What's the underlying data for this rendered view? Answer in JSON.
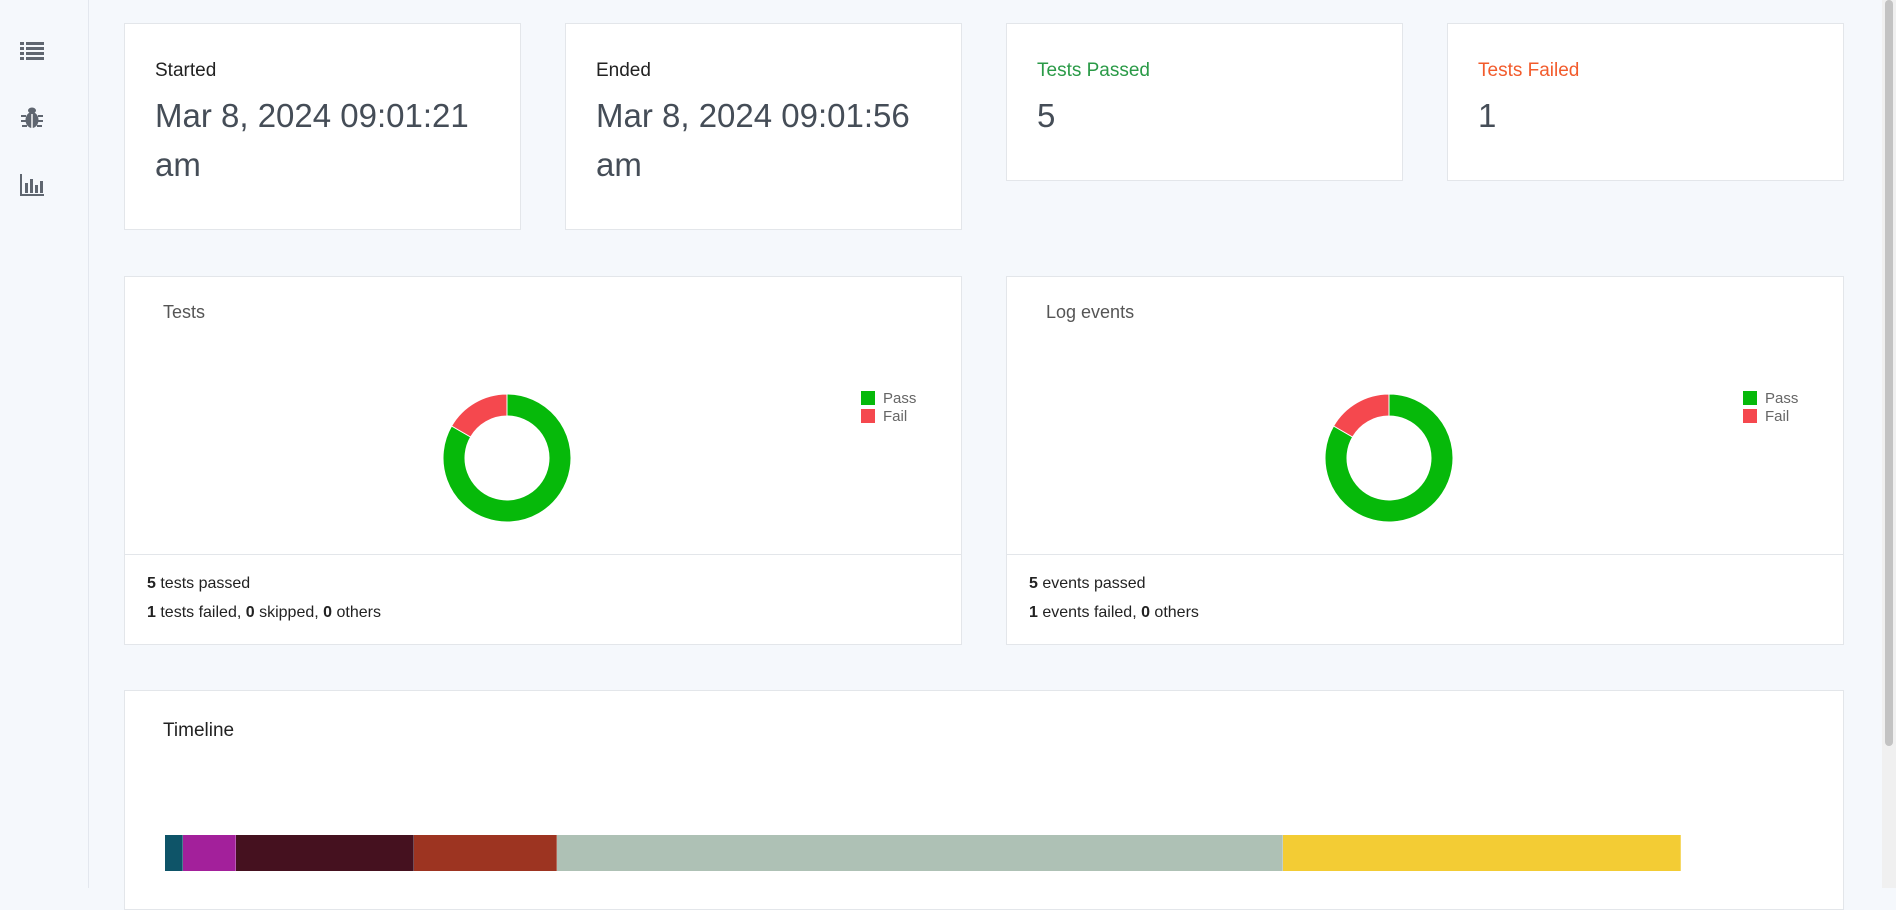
{
  "sidebar": {
    "items": [
      {
        "icon": "list-icon"
      },
      {
        "icon": "bug-icon"
      },
      {
        "icon": "bar-chart-icon"
      }
    ]
  },
  "stats": {
    "started": {
      "label": "Started",
      "value_line1": "Mar 8, 2024 09:01:21",
      "value_line2": "am"
    },
    "ended": {
      "label": "Ended",
      "value_line1": "Mar 8, 2024 09:01:56",
      "value_line2": "am"
    },
    "passed": {
      "label": "Tests Passed",
      "value": "5"
    },
    "failed": {
      "label": "Tests Failed",
      "value": "1"
    }
  },
  "colors": {
    "pass": "#06b90a",
    "fail": "#f5484e",
    "passed_label": "#2a9a47",
    "failed_label": "#f25b2c"
  },
  "tests_chart": {
    "title": "Tests",
    "legend": [
      "Pass",
      "Fail"
    ],
    "foot": {
      "line1_num": "5",
      "line1_text": " tests passed",
      "line2_num1": "1",
      "line2_text1": " tests failed, ",
      "line2_num2": "0",
      "line2_text2": " skipped, ",
      "line2_num3": "0",
      "line2_text3": " others"
    }
  },
  "events_chart": {
    "title": "Log events",
    "legend": [
      "Pass",
      "Fail"
    ],
    "foot": {
      "line1_num": "5",
      "line1_text": " events passed",
      "line2_num1": "1",
      "line2_text1": " events failed, ",
      "line2_num2": "0",
      "line2_text2": " others"
    }
  },
  "timeline": {
    "title": "Timeline"
  },
  "chart_data": [
    {
      "type": "pie",
      "title": "Tests",
      "categories": [
        "Pass",
        "Fail"
      ],
      "values": [
        5,
        1
      ],
      "colors": [
        "#06b90a",
        "#f5484e"
      ],
      "legend": "right"
    },
    {
      "type": "pie",
      "title": "Log events",
      "categories": [
        "Pass",
        "Fail"
      ],
      "values": [
        5,
        1
      ],
      "colors": [
        "#06b90a",
        "#f5484e"
      ],
      "legend": "right"
    },
    {
      "type": "bar",
      "title": "Timeline",
      "stacked": true,
      "series": [
        {
          "values": [
            0.6
          ],
          "color": "#0e5468"
        },
        {
          "values": [
            1.8
          ],
          "color": "#a3209b"
        },
        {
          "values": [
            6.0
          ],
          "color": "#45111f"
        },
        {
          "values": [
            4.8
          ],
          "color": "#9d3421"
        },
        {
          "values": [
            24.5
          ],
          "color": "#aec1b5"
        },
        {
          "values": [
            13.4
          ],
          "color": "#f3cc34"
        }
      ]
    }
  ]
}
